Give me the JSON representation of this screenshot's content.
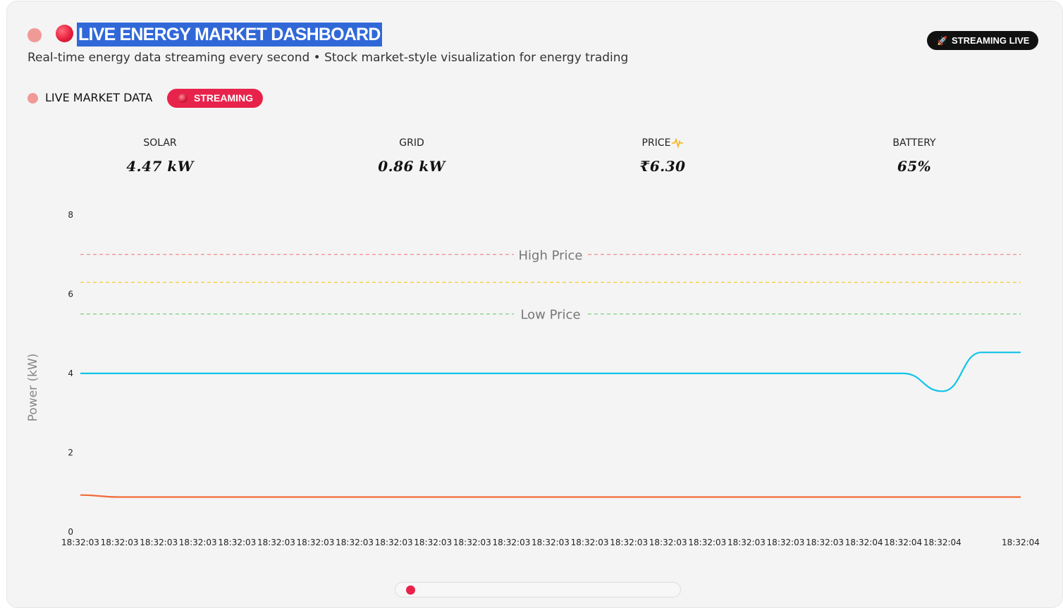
{
  "header": {
    "title": "LIVE ENERGY MARKET DASHBOARD",
    "subtitle": "Real-time energy data streaming every second • Stock market-style visualization for energy trading",
    "live_badge": "STREAMING LIVE"
  },
  "market": {
    "label": "LIVE MARKET DATA",
    "status": "STREAMING"
  },
  "metrics": [
    {
      "label": "SOLAR",
      "value": "4.47 kW"
    },
    {
      "label": "GRID",
      "value": "0.86 kW"
    },
    {
      "label": "PRICE",
      "value": "₹6.30"
    },
    {
      "label": "BATTERY",
      "value": "65%"
    }
  ],
  "colors": {
    "solar": "#0fc4e8",
    "grid": "#f26b3a",
    "high_price": "#f28b8b",
    "mid_price": "#f2cc2a",
    "low_price": "#7fce7f",
    "accent": "#e8234b"
  },
  "chart_data": {
    "type": "line",
    "title": "",
    "xlabel": "",
    "ylabel": "Power (kW)",
    "ylim": [
      0,
      8
    ],
    "yticks": [
      0,
      2,
      4,
      6,
      8
    ],
    "grid": false,
    "x": [
      "18:32:03",
      "18:32:03",
      "18:32:03",
      "18:32:03",
      "18:32:03",
      "18:32:03",
      "18:32:03",
      "18:32:03",
      "18:32:03",
      "18:32:03",
      "18:32:03",
      "18:32:03",
      "18:32:03",
      "18:32:03",
      "18:32:03",
      "18:32:03",
      "18:32:03",
      "18:32:03",
      "18:32:03",
      "18:32:03",
      "18:32:04",
      "18:32:04",
      "18:32:04",
      "18:32:04",
      "18:32:04"
    ],
    "xtick_labels": [
      "18:32:03",
      "18:32:03",
      "18:32:03",
      "18:32:03",
      "18:32:03",
      "18:32:03",
      "18:32:03",
      "18:32:03",
      "18:32:03",
      "18:32:03",
      "18:32:03",
      "18:32:03",
      "18:32:03",
      "18:32:03",
      "18:32:03",
      "18:32:03",
      "18:32:03",
      "18:32:03",
      "18:32:03",
      "18:32:03",
      "18:32:04",
      "18:32:04",
      "18:32:04",
      "",
      "18:32:04"
    ],
    "series": [
      {
        "key": "solar",
        "values": [
          4.0,
          4.0,
          4.0,
          4.0,
          4.0,
          4.0,
          4.0,
          4.0,
          4.0,
          4.0,
          4.0,
          4.0,
          4.0,
          4.0,
          4.0,
          4.0,
          4.0,
          4.0,
          4.0,
          4.0,
          4.0,
          4.0,
          3.55,
          4.53,
          4.53
        ]
      },
      {
        "key": "grid",
        "values": [
          0.93,
          0.88,
          0.88,
          0.88,
          0.88,
          0.88,
          0.88,
          0.88,
          0.88,
          0.88,
          0.88,
          0.88,
          0.88,
          0.88,
          0.88,
          0.88,
          0.88,
          0.88,
          0.88,
          0.88,
          0.88,
          0.88,
          0.88,
          0.88,
          0.88
        ]
      }
    ],
    "reference_lines": [
      {
        "key": "high_price",
        "y": 7.0,
        "label": "High Price"
      },
      {
        "key": "mid_price",
        "y": 6.3,
        "label": ""
      },
      {
        "key": "low_price",
        "y": 5.5,
        "label": "Low Price"
      }
    ]
  }
}
